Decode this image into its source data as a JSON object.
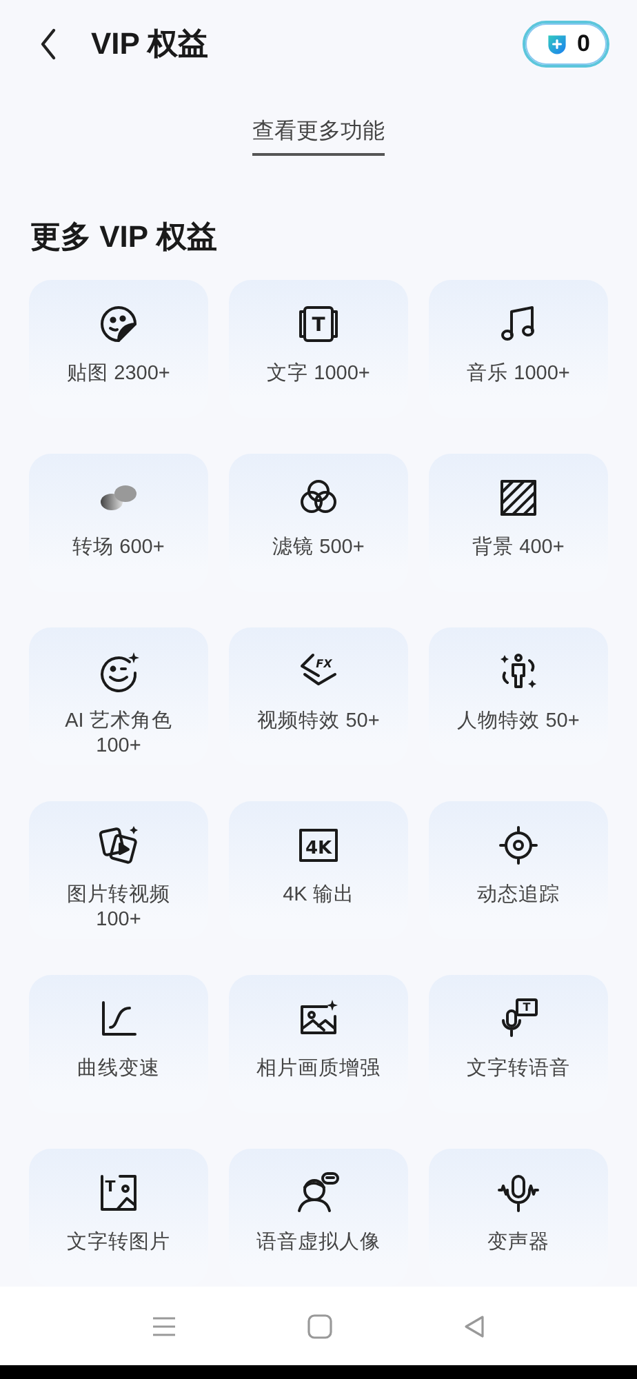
{
  "header": {
    "title": "VIP 权益",
    "coins": "0"
  },
  "more_link": "查看更多功能",
  "section_title": "更多 VIP 权益",
  "features": [
    {
      "label": "贴图 2300+"
    },
    {
      "label": "文字 1000+",
      "icon_text": "T"
    },
    {
      "label": "音乐 1000+"
    },
    {
      "label": "转场 600+"
    },
    {
      "label": "滤镜 500+"
    },
    {
      "label": "背景 400+"
    },
    {
      "label": "AI 艺术角色 100+"
    },
    {
      "label": "视频特效 50+",
      "icon_text": "FX"
    },
    {
      "label": "人物特效 50+"
    },
    {
      "label": "图片转视频 100+"
    },
    {
      "label": "4K 输出",
      "icon_text": "4K"
    },
    {
      "label": "动态追踪"
    },
    {
      "label": "曲线变速"
    },
    {
      "label": "相片画质增强"
    },
    {
      "label": "文字转语音",
      "icon_text": "T"
    },
    {
      "label": "文字转图片",
      "icon_text": "T"
    },
    {
      "label": "语音虚拟人像"
    },
    {
      "label": "变声器"
    }
  ],
  "nav_bar": {
    "buttons": [
      {
        "kind": "menu"
      },
      {
        "kind": "home"
      },
      {
        "kind": "back"
      }
    ]
  }
}
